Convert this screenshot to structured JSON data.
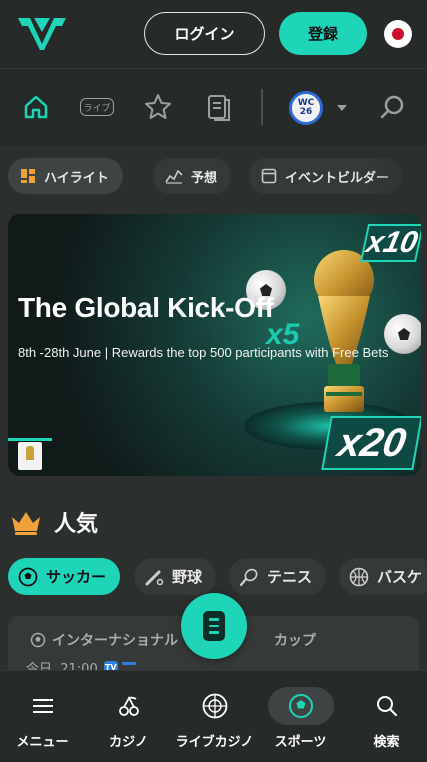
{
  "header": {
    "login_label": "ログイン",
    "register_label": "登録",
    "language_flag": "japan-flag-icon"
  },
  "top_nav": {
    "icons": [
      "home-icon",
      "live-icon",
      "star-icon",
      "betslip-icon",
      "wc26-icon",
      "search-icon"
    ],
    "live_label": "ライブ",
    "wc_badge_text": "WC 26"
  },
  "category_chips": [
    {
      "label": "ハイライト",
      "icon": "highlight-icon",
      "active": true
    },
    {
      "label": "予想",
      "icon": "prediction-icon",
      "active": false
    },
    {
      "label": "イベントビルダー",
      "icon": "event-builder-icon",
      "active": false
    }
  ],
  "banner": {
    "title": "The Global Kick-Off",
    "subtitle": "8th -28th June | Rewards the top 500 participants with Free Bets",
    "multipliers": [
      "x10",
      "x5",
      "x20"
    ]
  },
  "popular": {
    "title": "人気",
    "icon": "crown-icon"
  },
  "sports_tabs": [
    {
      "label": "サッカー",
      "icon": "soccer-icon",
      "active": true
    },
    {
      "label": "野球",
      "icon": "baseball-icon",
      "active": false
    },
    {
      "label": "テニス",
      "icon": "tennis-icon",
      "active": false
    },
    {
      "label": "バスケ",
      "icon": "basketball-icon",
      "active": false
    }
  ],
  "match": {
    "league_prefix": "インターナショナル",
    "league_suffix": "カップ",
    "time": "今日, 21:00",
    "live_badge": "TV"
  },
  "bottom_nav": [
    {
      "label": "メニュー",
      "icon": "menu-icon",
      "active": false
    },
    {
      "label": "カジノ",
      "icon": "casino-icon",
      "active": false
    },
    {
      "label": "ライブカジノ",
      "icon": "live-casino-icon",
      "active": false
    },
    {
      "label": "スポーツ",
      "icon": "sports-icon",
      "active": true
    },
    {
      "label": "検索",
      "icon": "search-icon",
      "active": false
    }
  ],
  "colors": {
    "accent": "#1ed5b8",
    "background": "#2b2f2e",
    "surface": "#353a39"
  }
}
